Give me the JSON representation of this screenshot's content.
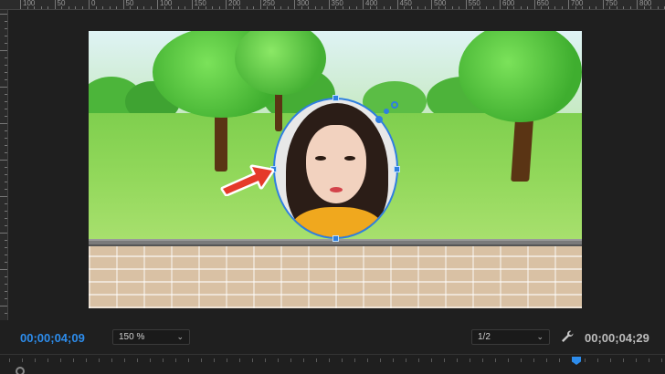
{
  "ruler": {
    "labels": [
      "100",
      "50",
      "0",
      "50",
      "100",
      "150",
      "200",
      "250",
      "300",
      "350",
      "400",
      "450",
      "500",
      "550",
      "600",
      "650",
      "700",
      "750",
      "800"
    ]
  },
  "monitor": {
    "current_timecode": "00;00;04;09",
    "duration_timecode": "00;00;04;29",
    "zoom_level": "150 %",
    "resolution": "1/2",
    "accent_color": "#2d8ceb"
  },
  "icons": {
    "settings": "wrench-icon",
    "annotation": "red-arrow-icon",
    "dropdown": "chevron-down-icon"
  }
}
